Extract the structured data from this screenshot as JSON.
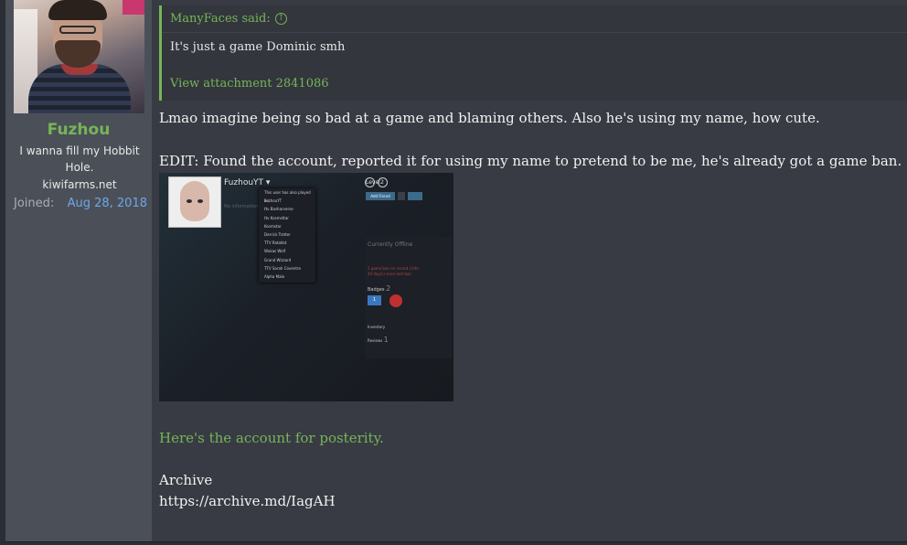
{
  "user": {
    "name": "Fuzhou",
    "title_line1": "I wanna fill my Hobbit",
    "title_line2": "Hole.",
    "title_line3": "kiwifarms.net",
    "joined_label": "Joined:",
    "joined_value": "Aug 28, 2018"
  },
  "quote": {
    "author_line": "ManyFaces said:",
    "text": "It's just a game Dominic smh",
    "attachment_link": "View attachment 2841086"
  },
  "message": {
    "line1": "Lmao imagine being so bad at a game and blaming others. Also he's using my name, how cute.",
    "line2": "EDIT: Found the account, reported it for using my name to pretend to be me, he's already got a game ban.",
    "posterity_link": "Here's the account for posterity.",
    "archive_label": "Archive",
    "archive_url": "https://archive.md/IagAH"
  },
  "screenshot": {
    "profile_name": "FuzhouYT",
    "no_info": "No information given.",
    "dropdown_header": "This user has also played as:",
    "aliases": [
      "FuzhouYT",
      "ttv Basharverse",
      "ttv Kosmsttar",
      "Kosmstar",
      "Derrick Trotter",
      "TTV Ratatkd",
      "Wukas Wolf",
      "Grand Wizzard",
      "TTV Sarah Coventre",
      "Alpha Male"
    ],
    "level_label": "Level",
    "level_value": "2",
    "add_friend": "Add Friend",
    "status": "Currently Offline",
    "ban_line1": "1 game ban on record | Info",
    "ban_line2": "44 day(s) since last ban",
    "badges_label": "Badges",
    "badges_count": "2",
    "badge_value": "1",
    "inventory_label": "Inventory",
    "reviews_label": "Reviews",
    "reviews_count": "1"
  },
  "colors": {
    "accent_green": "#76b558",
    "link_blue": "#6ea6e8",
    "post_bg": "#383b43",
    "user_col_bg": "#4b5058"
  }
}
